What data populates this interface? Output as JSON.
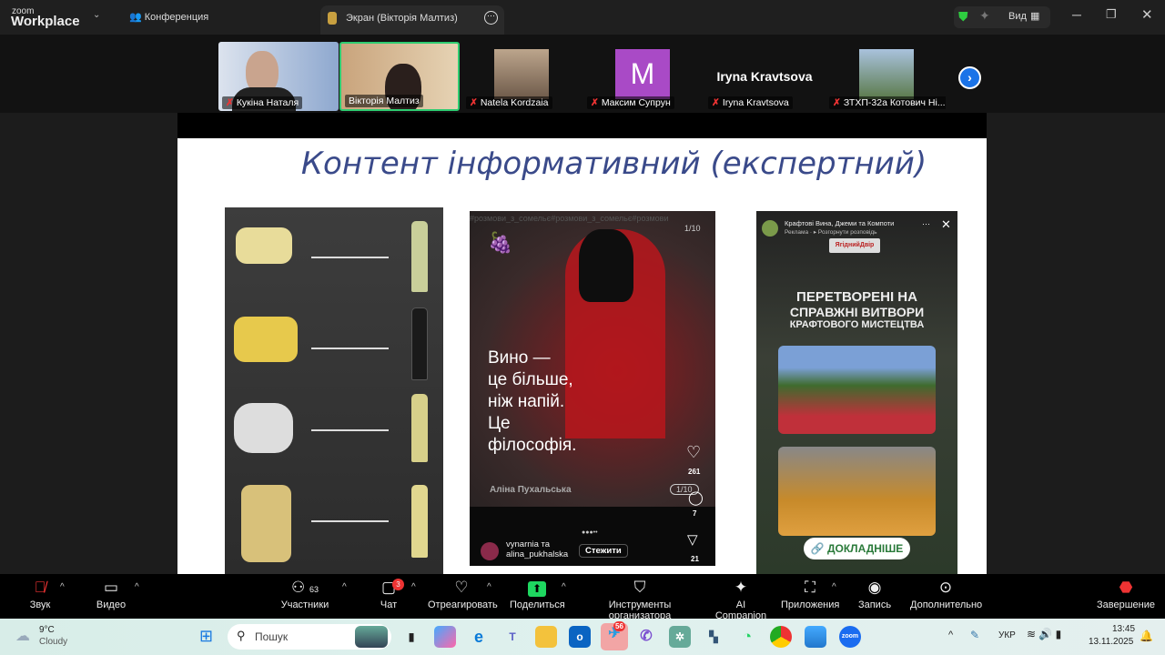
{
  "titlebar": {
    "logo_small": "zoom",
    "logo_big": "Workplace",
    "meeting_tab": "Конференция",
    "screen_tab": "Экран (Вікторія Малтиз)",
    "view_label": "Вид"
  },
  "gallery": {
    "participants": [
      {
        "name": "Кукіна Наталя",
        "muted": true
      },
      {
        "name": "Вікторія Малтиз",
        "muted": false,
        "active": true
      },
      {
        "name": "Natela Kordzaia",
        "muted": true
      },
      {
        "name": "Максим Супрун",
        "muted": true,
        "initial": "M"
      },
      {
        "name": "Iryna Kravtsova",
        "muted": true,
        "display_name": "Iryna Kravtsova"
      },
      {
        "name": "ЗТХП-32а Котович Ні...",
        "muted": true
      }
    ]
  },
  "slide": {
    "title": "Контент інформативний (експертний)",
    "post": {
      "hashtags": "#розмови_з_сомельє#розмови_з_сомельє#розмови",
      "counter": "1/10",
      "headline": [
        "Вино —",
        "це більше,",
        "ніж напій.",
        "Це",
        "філософія."
      ],
      "author": "Аліна Пухальська",
      "badge": "1/10",
      "likes": "261",
      "comments": "7",
      "shares": "21",
      "account1": "vynarnia та",
      "account2": "alina_pukhalska",
      "follow": "Стежити"
    },
    "ad": {
      "page": "Крафтові Вина, Джеми та Компоти",
      "sponsored": "Реклама · ▸ Розгорнути розповідь",
      "brand": "ЯгіднийДвір",
      "headline1": "ПЕРЕТВОРЕНІ НА",
      "headline2": "СПРАВЖНІ ВИТВОРИ",
      "headline3": "КРАФТОВОГО МИСТЕЦТВА",
      "cta": "🔗 ДОКЛАДНІШЕ"
    }
  },
  "toolbar": {
    "audio": "Звук",
    "video": "Видео",
    "participants": "Участники",
    "participants_count": "63",
    "chat": "Чат",
    "chat_badge": "3",
    "react": "Отреагировать",
    "share": "Поделиться",
    "host_tools": "Инструменты организатора",
    "ai": "AI Companion",
    "apps": "Приложения",
    "record": "Запись",
    "more": "Дополнительно",
    "end": "Завершение"
  },
  "taskbar": {
    "temp": "9°C",
    "weather": "Cloudy",
    "search": "Пошук",
    "telegram_badge": "56",
    "lang": "УКР",
    "time": "13:45",
    "date": "13.11.2025"
  }
}
